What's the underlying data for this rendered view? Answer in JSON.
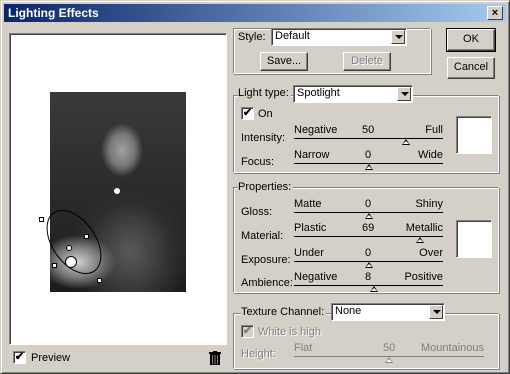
{
  "window": {
    "title": "Lighting Effects",
    "close_glyph": "×"
  },
  "preview": {
    "checkbox_label": "Preview",
    "checked_glyph": "✔"
  },
  "style": {
    "label": "Style:",
    "value": "Default",
    "save_label": "Save...",
    "delete_label": "Delete"
  },
  "buttons": {
    "ok_label": "OK",
    "cancel_label": "Cancel"
  },
  "light": {
    "label": "Light type:",
    "type_value": "Spotlight",
    "on_label": "On",
    "on_glyph": "✔",
    "intensity": {
      "label": "Intensity:",
      "left": "Negative",
      "value": "50",
      "right": "Full",
      "fraction": 0.75
    },
    "focus": {
      "label": "Focus:",
      "left": "Narrow",
      "value": "0",
      "right": "Wide",
      "fraction": 0.5
    },
    "color": "#ffffff"
  },
  "properties": {
    "label": "Properties:",
    "gloss": {
      "label": "Gloss:",
      "left": "Matte",
      "value": "0",
      "right": "Shiny",
      "fraction": 0.5
    },
    "material": {
      "label": "Material:",
      "left": "Plastic",
      "value": "69",
      "right": "Metallic",
      "fraction": 0.845
    },
    "exposure": {
      "label": "Exposure:",
      "left": "Under",
      "value": "0",
      "right": "Over",
      "fraction": 0.5
    },
    "ambience": {
      "label": "Ambience:",
      "left": "Negative",
      "value": "8",
      "right": "Positive",
      "fraction": 0.54
    },
    "color": "#ffffff"
  },
  "texture": {
    "label": "Texture Channel:",
    "value": "None",
    "white_is_high_label": "White is high",
    "height": {
      "label": "Height:",
      "left": "Flat",
      "value": "50",
      "right": "Mountainous",
      "fraction": 0.5
    }
  },
  "icons": {
    "trash": "trash-icon"
  }
}
